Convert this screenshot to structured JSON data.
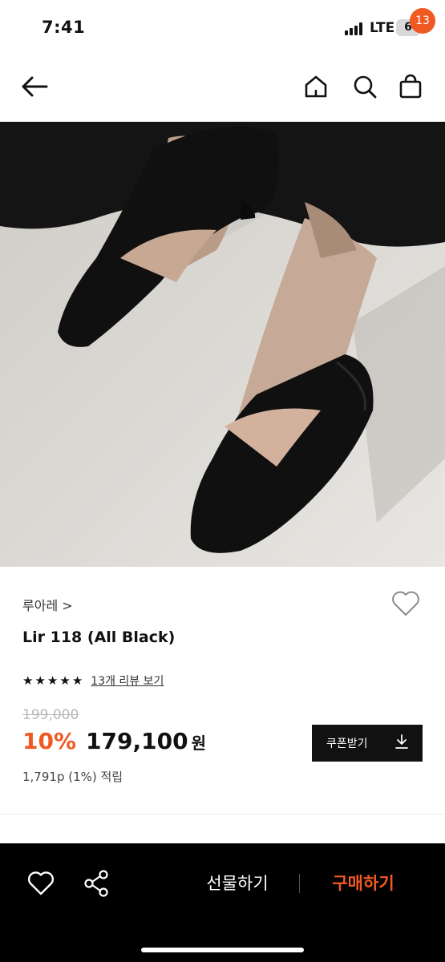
{
  "status_bar": {
    "time": "7:41",
    "network": "LTE",
    "battery": "6"
  },
  "header": {
    "cart_count": "13",
    "icons": [
      "back-arrow-icon",
      "home-icon",
      "search-icon",
      "cart-icon"
    ],
    "accent_color": "#f05a22"
  },
  "product": {
    "brand": "루아레 >",
    "title": "Lir 118 (All Black)",
    "rating_stars": 5,
    "review_link": "13개 리뷰 보기",
    "original_price": "199,000",
    "discount_rate": "10%",
    "sale_price": "179,100",
    "price_unit": "원",
    "points": "1,791p (1%) 적립",
    "coupon_label": "쿠폰받기"
  },
  "bottom_bar": {
    "gift_label": "선물하기",
    "buy_label": "구매하기",
    "icons": [
      "heart-icon",
      "share-icon"
    ]
  },
  "colors": {
    "accent": "#f05a22",
    "dark": "#111111",
    "background": "#ffffff"
  }
}
